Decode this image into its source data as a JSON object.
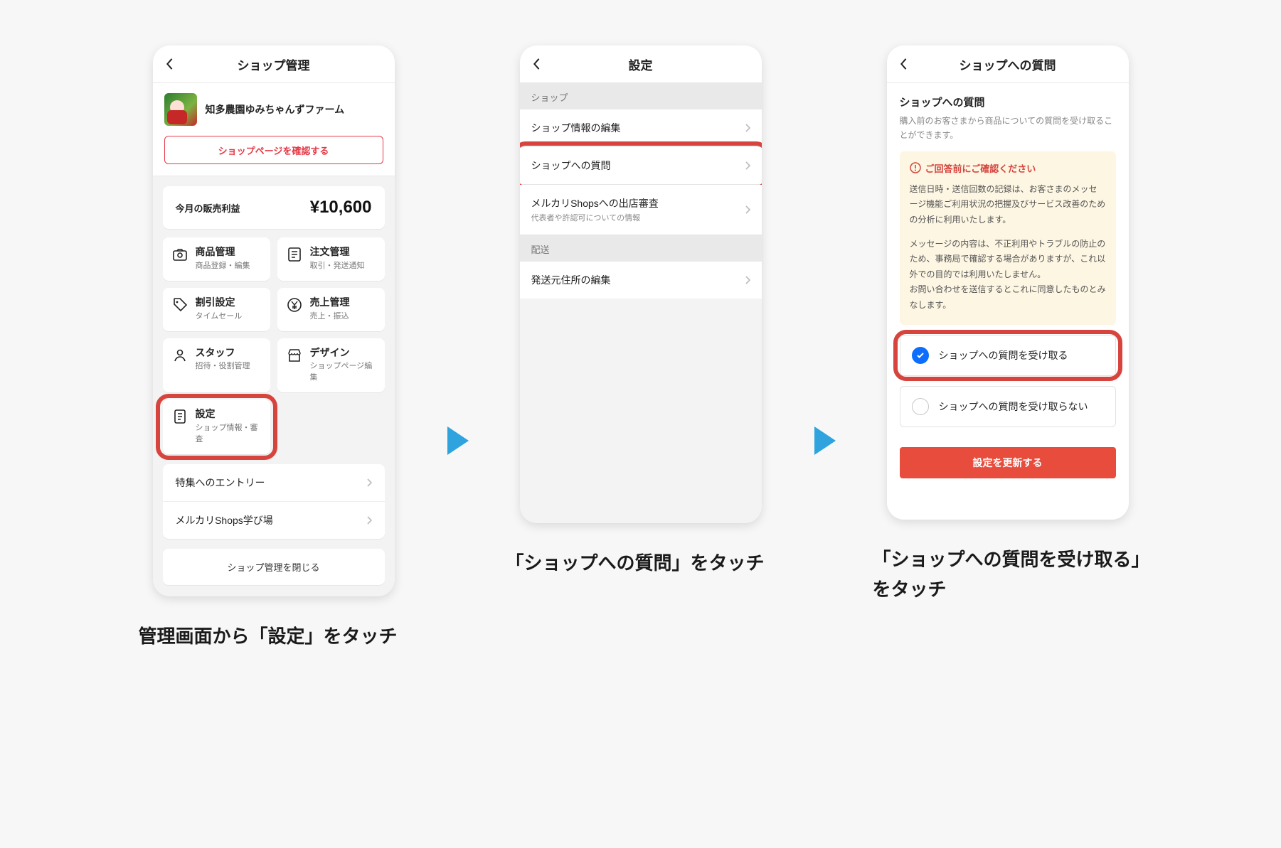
{
  "captions": {
    "c1": "管理画面から「設定」をタッチ",
    "c2": "「ショップへの質問」をタッチ",
    "c3": "「ショップへの質問を受け取る」をタッチ"
  },
  "s1": {
    "title": "ショップ管理",
    "shop_name": "知多農園ゆみちゃんずファーム",
    "confirm_btn": "ショップページを確認する",
    "profit_label": "今月の販売利益",
    "profit_value": "¥10,600",
    "tiles": {
      "products": {
        "title": "商品管理",
        "sub": "商品登録・編集"
      },
      "orders": {
        "title": "注文管理",
        "sub": "取引・発送通知"
      },
      "discount": {
        "title": "割引設定",
        "sub": "タイムセール"
      },
      "sales": {
        "title": "売上管理",
        "sub": "売上・振込"
      },
      "staff": {
        "title": "スタッフ",
        "sub": "招待・役割管理"
      },
      "design": {
        "title": "デザイン",
        "sub": "ショップページ編集"
      },
      "settings": {
        "title": "設定",
        "sub": "ショップ情報・審査"
      }
    },
    "entry_row": "特集へのエントリー",
    "study_row": "メルカリShops学び場",
    "close_row": "ショップ管理を閉じる"
  },
  "s2": {
    "title": "設定",
    "sec_shop": "ショップ",
    "rows": {
      "edit": "ショップ情報の編集",
      "question": "ショップへの質問",
      "review_title": "メルカリShopsへの出店審査",
      "review_sub": "代表者や許認可についての情報"
    },
    "sec_ship": "配送",
    "ship_row": "発送元住所の編集"
  },
  "s3": {
    "title": "ショップへの質問",
    "heading": "ショップへの質問",
    "desc": "購入前のお客さまから商品についての質問を受け取ることができます。",
    "notice_title": "ご回答前にご確認ください",
    "notice_body1": "送信日時・送信回数の記録は、お客さまのメッセージ機能ご利用状況の把握及びサービス改善のための分析に利用いたします。",
    "notice_body2": "メッセージの内容は、不正利用やトラブルの防止のため、事務局で確認する場合がありますが、これ以外での目的では利用いたしません。\nお問い合わせを送信するとこれに同意したものとみなします。",
    "opt_accept": "ショップへの質問を受け取る",
    "opt_reject": "ショップへの質問を受け取らない",
    "save_btn": "設定を更新する"
  }
}
